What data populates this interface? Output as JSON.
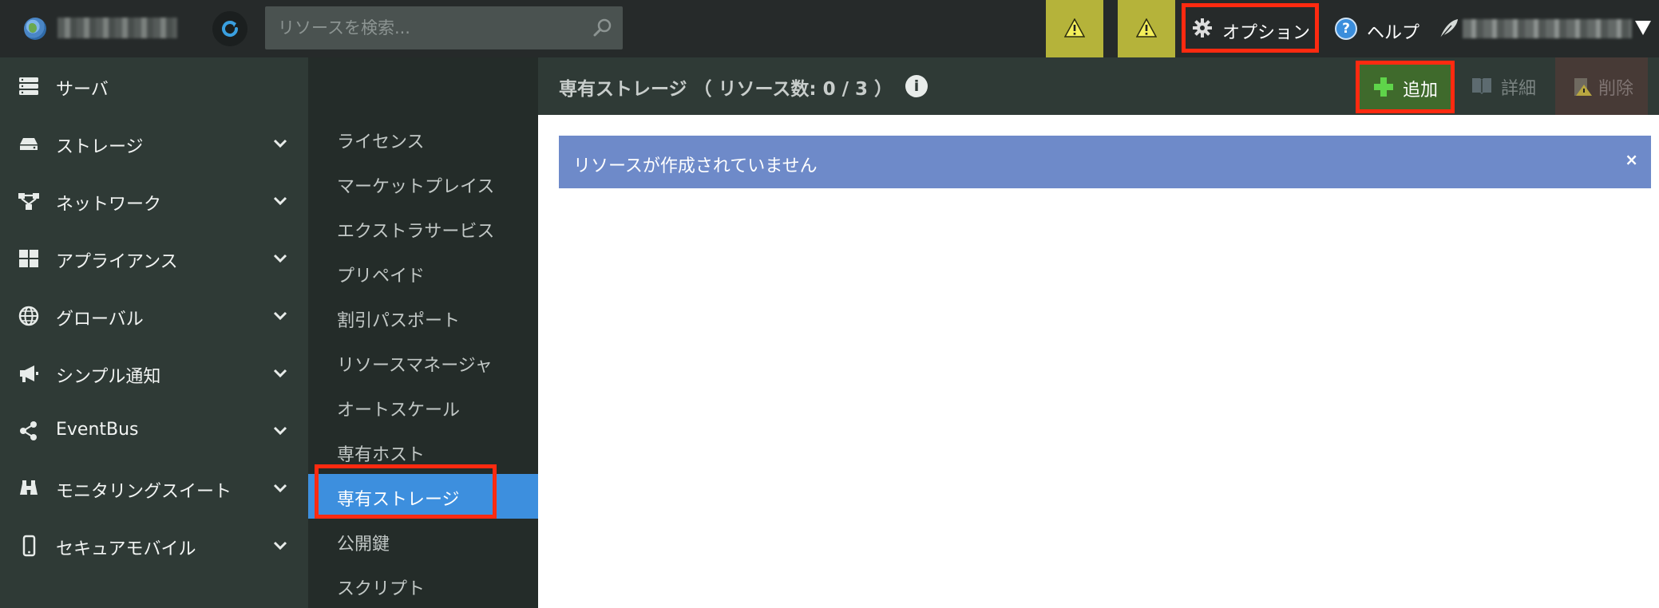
{
  "topbar": {
    "search_placeholder": "リソースを検索...",
    "options_label": "オプション",
    "help_label": "ヘルプ",
    "help_glyph": "?"
  },
  "sidebar": {
    "items": [
      {
        "label": "サーバ",
        "icon": "server-icon",
        "has_chevron": false
      },
      {
        "label": "ストレージ",
        "icon": "storage-icon",
        "has_chevron": true
      },
      {
        "label": "ネットワーク",
        "icon": "network-icon",
        "has_chevron": true
      },
      {
        "label": "アプライアンス",
        "icon": "appliance-grid-icon",
        "has_chevron": true
      },
      {
        "label": "グローバル",
        "icon": "globe-icon",
        "has_chevron": true
      },
      {
        "label": "シンプル通知",
        "icon": "megaphone-icon",
        "has_chevron": true
      },
      {
        "label": "EventBus",
        "icon": "share-icon",
        "has_chevron": true
      },
      {
        "label": "モニタリングスイート",
        "icon": "binoculars-icon",
        "has_chevron": true
      },
      {
        "label": "セキュアモバイル",
        "icon": "mobile-icon",
        "has_chevron": true
      }
    ]
  },
  "submenu": {
    "items": [
      {
        "label": "ライセンス"
      },
      {
        "label": "マーケットプレイス"
      },
      {
        "label": "エクストラサービス"
      },
      {
        "label": "プリペイド"
      },
      {
        "label": "割引パスポート"
      },
      {
        "label": "リソースマネージャ"
      },
      {
        "label": "オートスケール"
      },
      {
        "label": "専有ホスト"
      },
      {
        "label": "専有ストレージ",
        "active": true
      },
      {
        "label": "公開鍵"
      },
      {
        "label": "スクリプト"
      }
    ]
  },
  "content": {
    "title": "専有ストレージ （ リソース数: 0 / 3 ）",
    "info_glyph": "i",
    "add_label": "追加",
    "detail_label": "詳細",
    "delete_label": "削除",
    "alert_message": "リソースが作成されていません",
    "alert_close": "×"
  },
  "colors": {
    "topbar_bg": "#262a2a",
    "sidebar_bg": "#2f3a36",
    "submenu_bg": "#242c29",
    "active_item": "#3d8fde",
    "warning": "#b5b33a",
    "add_button": "#3f6a2c",
    "alert_bg": "#6e8ac9",
    "highlight_box": "#ff2a10"
  }
}
